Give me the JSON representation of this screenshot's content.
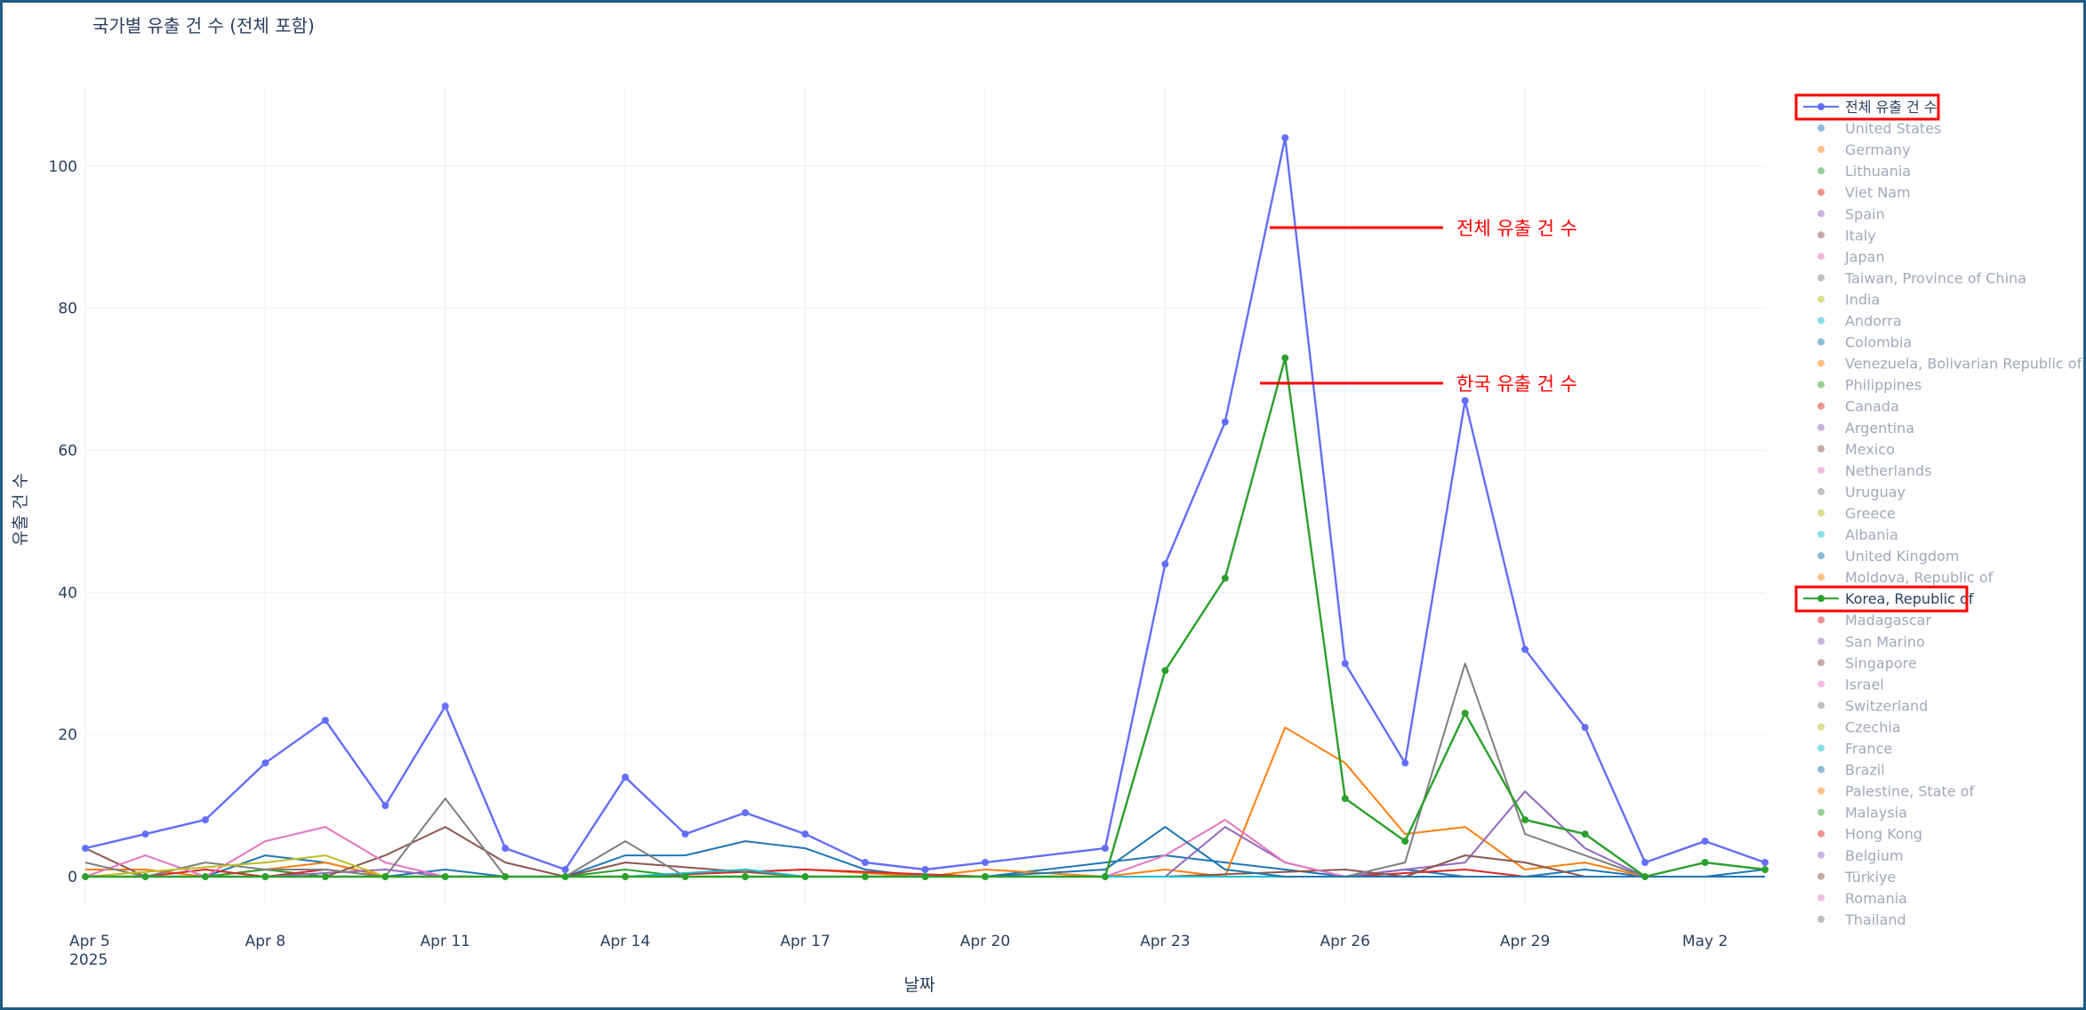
{
  "chart_data": {
    "type": "line",
    "title": "국가별 유출 건 수 (전체 포함)",
    "xlabel": "날짜",
    "ylabel": "유출 건 수",
    "x_year": "2025",
    "x_start": "2025-04-05",
    "x_end": "2025-05-03",
    "ylim": [
      -4,
      111
    ],
    "y_ticks": [
      0,
      20,
      40,
      60,
      80,
      100
    ],
    "x_ticks": [
      {
        "date": "2025-04-05",
        "label": "Apr 5"
      },
      {
        "date": "2025-04-08",
        "label": "Apr 8"
      },
      {
        "date": "2025-04-11",
        "label": "Apr 11"
      },
      {
        "date": "2025-04-14",
        "label": "Apr 14"
      },
      {
        "date": "2025-04-17",
        "label": "Apr 17"
      },
      {
        "date": "2025-04-20",
        "label": "Apr 20"
      },
      {
        "date": "2025-04-23",
        "label": "Apr 23"
      },
      {
        "date": "2025-04-26",
        "label": "Apr 26"
      },
      {
        "date": "2025-04-29",
        "label": "Apr 29"
      },
      {
        "date": "2025-05-02",
        "label": "May 2"
      }
    ],
    "grid": true,
    "legend_position": "right",
    "series": [
      {
        "name": "전체 유출 건 수",
        "color": "#636efa",
        "visible": true,
        "markers": true,
        "highlight": true,
        "x": [
          "2025-04-05",
          "2025-04-06",
          "2025-04-07",
          "2025-04-08",
          "2025-04-09",
          "2025-04-10",
          "2025-04-11",
          "2025-04-12",
          "2025-04-13",
          "2025-04-14",
          "2025-04-15",
          "2025-04-16",
          "2025-04-17",
          "2025-04-18",
          "2025-04-19",
          "2025-04-20",
          "2025-04-22",
          "2025-04-23",
          "2025-04-24",
          "2025-04-25",
          "2025-04-26",
          "2025-04-27",
          "2025-04-28",
          "2025-04-29",
          "2025-04-30",
          "2025-05-01",
          "2025-05-02",
          "2025-05-03"
        ],
        "y": [
          4,
          6,
          8,
          16,
          22,
          10,
          24,
          4,
          1,
          14,
          6,
          9,
          6,
          2,
          1,
          2,
          4,
          44,
          64,
          104,
          30,
          16,
          67,
          32,
          21,
          2,
          5,
          2
        ]
      },
      {
        "name": "United States",
        "color": "#1f77b4",
        "visible": false,
        "x": [
          "2025-04-05",
          "2025-04-07",
          "2025-04-08",
          "2025-04-09",
          "2025-04-10",
          "2025-04-11",
          "2025-04-12",
          "2025-04-13",
          "2025-04-14",
          "2025-04-15",
          "2025-04-16",
          "2025-04-17",
          "2025-04-18",
          "2025-04-19",
          "2025-04-20",
          "2025-04-22",
          "2025-04-23",
          "2025-04-24",
          "2025-04-25",
          "2025-04-26",
          "2025-04-27",
          "2025-04-28",
          "2025-04-29",
          "2025-04-30",
          "2025-05-01",
          "2025-05-02",
          "2025-05-03"
        ],
        "y": [
          0,
          0,
          3,
          2,
          0,
          1,
          0,
          0,
          3,
          3,
          5,
          4,
          1,
          0,
          0,
          2,
          3,
          2,
          1,
          0,
          1,
          0,
          0,
          1,
          0,
          0,
          1
        ]
      },
      {
        "name": "Germany",
        "color": "#ff7f0e",
        "visible": false,
        "x": [
          "2025-04-05",
          "2025-04-06",
          "2025-04-07",
          "2025-04-08",
          "2025-04-09",
          "2025-04-10",
          "2025-04-11",
          "2025-04-14",
          "2025-04-17",
          "2025-04-19",
          "2025-04-20",
          "2025-04-22",
          "2025-04-23",
          "2025-04-24",
          "2025-04-25",
          "2025-04-26",
          "2025-04-27",
          "2025-04-28",
          "2025-04-29",
          "2025-04-30",
          "2025-05-01",
          "2025-05-02",
          "2025-05-03"
        ],
        "y": [
          1,
          1,
          0,
          1,
          2,
          0,
          0,
          0,
          1,
          0,
          1,
          0,
          1,
          0,
          21,
          16,
          6,
          7,
          1,
          2,
          0,
          0,
          0
        ]
      },
      {
        "name": "Lithuania",
        "color": "#2ca02c",
        "visible": false,
        "markers": true,
        "x": [
          "2025-04-05",
          "2025-04-06",
          "2025-04-07",
          "2025-04-08",
          "2025-04-09",
          "2025-04-10",
          "2025-04-11",
          "2025-04-13",
          "2025-04-14",
          "2025-04-15",
          "2025-04-17",
          "2025-04-18",
          "2025-04-19",
          "2025-04-20",
          "2025-04-22",
          "2025-04-23",
          "2025-04-24",
          "2025-04-25",
          "2025-04-26",
          "2025-04-27",
          "2025-04-28",
          "2025-04-29",
          "2025-04-30",
          "2025-05-01",
          "2025-05-02",
          "2025-05-03"
        ],
        "y": [
          0,
          0,
          0,
          1,
          0,
          0,
          0,
          0,
          1,
          0,
          0,
          0,
          0,
          0,
          0,
          29,
          42,
          73,
          11,
          5,
          23,
          8,
          6,
          0,
          2,
          1
        ]
      },
      {
        "name": "Viet Nam",
        "color": "#d62728",
        "visible": false,
        "x": [
          "2025-04-05",
          "2025-04-06",
          "2025-04-07",
          "2025-04-08",
          "2025-04-09",
          "2025-04-10",
          "2025-04-11",
          "2025-04-14",
          "2025-04-17",
          "2025-04-20",
          "2025-04-23",
          "2025-04-26",
          "2025-04-28",
          "2025-04-29",
          "2025-05-01",
          "2025-05-03"
        ],
        "y": [
          0,
          0,
          1,
          0,
          1,
          0,
          0,
          0,
          1,
          0,
          0,
          0,
          1,
          0,
          0,
          0
        ]
      },
      {
        "name": "Spain",
        "color": "#9467bd",
        "visible": false,
        "x": [
          "2025-04-05",
          "2025-04-08",
          "2025-04-10",
          "2025-04-11",
          "2025-04-14",
          "2025-04-20",
          "2025-04-23",
          "2025-04-24",
          "2025-04-25",
          "2025-04-26",
          "2025-04-27",
          "2025-04-28",
          "2025-04-29",
          "2025-04-30",
          "2025-05-01",
          "2025-05-03"
        ],
        "y": [
          0,
          0,
          1,
          0,
          0,
          0,
          0,
          7,
          2,
          0,
          1,
          2,
          12,
          4,
          0,
          0
        ]
      },
      {
        "name": "Italy",
        "color": "#8c564b",
        "visible": false,
        "x": [
          "2025-04-05",
          "2025-04-06",
          "2025-04-07",
          "2025-04-08",
          "2025-04-09",
          "2025-04-10",
          "2025-04-11",
          "2025-04-12",
          "2025-04-13",
          "2025-04-14",
          "2025-04-17",
          "2025-04-20",
          "2025-04-23",
          "2025-04-26",
          "2025-04-27",
          "2025-04-28",
          "2025-04-29",
          "2025-04-30",
          "2025-05-01",
          "2025-05-03"
        ],
        "y": [
          4,
          0,
          0,
          0,
          0,
          3,
          7,
          2,
          0,
          2,
          0,
          0,
          0,
          1,
          0,
          3,
          2,
          0,
          0,
          0
        ]
      },
      {
        "name": "Japan",
        "color": "#e377c2",
        "visible": false,
        "x": [
          "2025-04-05",
          "2025-04-06",
          "2025-04-07",
          "2025-04-08",
          "2025-04-09",
          "2025-04-10",
          "2025-04-11",
          "2025-04-14",
          "2025-04-17",
          "2025-04-20",
          "2025-04-22",
          "2025-04-23",
          "2025-04-24",
          "2025-04-25",
          "2025-04-26",
          "2025-04-29",
          "2025-05-03"
        ],
        "y": [
          0,
          3,
          0,
          5,
          7,
          2,
          0,
          0,
          0,
          0,
          0,
          3,
          8,
          2,
          0,
          0,
          0
        ]
      },
      {
        "name": "Taiwan, Province of China",
        "color": "#7f7f7f",
        "visible": false,
        "x": [
          "2025-04-05",
          "2025-04-06",
          "2025-04-07",
          "2025-04-08",
          "2025-04-09",
          "2025-04-10",
          "2025-04-11",
          "2025-04-12",
          "2025-04-13",
          "2025-04-14",
          "2025-04-15",
          "2025-04-17",
          "2025-04-20",
          "2025-04-23",
          "2025-04-26",
          "2025-04-27",
          "2025-04-28",
          "2025-04-29",
          "2025-04-30",
          "2025-05-01",
          "2025-05-03"
        ],
        "y": [
          2,
          0,
          2,
          1,
          1,
          0,
          11,
          0,
          0,
          5,
          0,
          0,
          0,
          0,
          0,
          2,
          30,
          6,
          3,
          0,
          0
        ]
      },
      {
        "name": "India",
        "color": "#bcbd22",
        "visible": false,
        "x": [
          "2025-04-05",
          "2025-04-08",
          "2025-04-09",
          "2025-04-10",
          "2025-04-11",
          "2025-04-14",
          "2025-04-20",
          "2025-04-23",
          "2025-04-26",
          "2025-05-03"
        ],
        "y": [
          0,
          2,
          3,
          0,
          0,
          0,
          0,
          0,
          0,
          0
        ]
      },
      {
        "name": "Andorra",
        "color": "#17becf",
        "visible": false,
        "x": [
          "2025-04-05",
          "2025-04-14",
          "2025-04-16",
          "2025-04-17",
          "2025-04-23",
          "2025-05-03"
        ],
        "y": [
          0,
          0,
          1,
          0,
          0,
          0
        ]
      },
      {
        "name": "Colombia",
        "color": "#1f77b4",
        "visible": false,
        "x": [
          "2025-04-05",
          "2025-04-20",
          "2025-04-22",
          "2025-04-23",
          "2025-04-24",
          "2025-04-25",
          "2025-05-03"
        ],
        "y": [
          0,
          0,
          1,
          7,
          1,
          0,
          0
        ]
      },
      {
        "name": "Venezuela, Bolivarian Republic of",
        "color": "#ff7f0e",
        "visible": false,
        "x": [],
        "y": []
      },
      {
        "name": "Philippines",
        "color": "#2ca02c",
        "visible": false,
        "x": [],
        "y": []
      },
      {
        "name": "Canada",
        "color": "#d62728",
        "visible": false,
        "x": [],
        "y": []
      },
      {
        "name": "Argentina",
        "color": "#9467bd",
        "visible": false,
        "x": [],
        "y": []
      },
      {
        "name": "Mexico",
        "color": "#8c564b",
        "visible": false,
        "x": [],
        "y": []
      },
      {
        "name": "Netherlands",
        "color": "#e377c2",
        "visible": false,
        "x": [],
        "y": []
      },
      {
        "name": "Uruguay",
        "color": "#7f7f7f",
        "visible": false,
        "x": [],
        "y": []
      },
      {
        "name": "Greece",
        "color": "#bcbd22",
        "visible": false,
        "x": [],
        "y": []
      },
      {
        "name": "Albania",
        "color": "#17becf",
        "visible": false,
        "x": [],
        "y": []
      },
      {
        "name": "United Kingdom",
        "color": "#1f77b4",
        "visible": false,
        "x": [],
        "y": []
      },
      {
        "name": "Moldova, Republic of",
        "color": "#ff7f0e",
        "visible": false,
        "x": [],
        "y": []
      },
      {
        "name": "Korea, Republic of",
        "color": "#2ca02c",
        "visible": true,
        "markers": true,
        "highlight": true,
        "x": [
          "2025-04-05",
          "2025-04-06",
          "2025-04-07",
          "2025-04-08",
          "2025-04-09",
          "2025-04-10",
          "2025-04-11",
          "2025-04-12",
          "2025-04-13",
          "2025-04-14",
          "2025-04-15",
          "2025-04-16",
          "2025-04-17",
          "2025-04-18",
          "2025-04-19",
          "2025-04-20",
          "2025-04-22",
          "2025-04-23",
          "2025-04-24",
          "2025-04-25",
          "2025-04-26",
          "2025-04-27",
          "2025-04-28",
          "2025-04-29",
          "2025-04-30",
          "2025-05-01",
          "2025-05-02",
          "2025-05-03"
        ],
        "y": [
          0,
          0,
          0,
          0,
          0,
          0,
          0,
          0,
          0,
          0,
          0,
          0,
          0,
          0,
          0,
          0,
          0,
          29,
          42,
          73,
          11,
          5,
          23,
          8,
          6,
          0,
          2,
          1
        ]
      },
      {
        "name": "Madagascar",
        "color": "#d62728",
        "visible": false,
        "x": [],
        "y": []
      },
      {
        "name": "San Marino",
        "color": "#9467bd",
        "visible": false,
        "x": [],
        "y": []
      },
      {
        "name": "Singapore",
        "color": "#8c564b",
        "visible": false,
        "x": [],
        "y": []
      },
      {
        "name": "Israel",
        "color": "#e377c2",
        "visible": false,
        "x": [],
        "y": []
      },
      {
        "name": "Switzerland",
        "color": "#7f7f7f",
        "visible": false,
        "x": [],
        "y": []
      },
      {
        "name": "Czechia",
        "color": "#bcbd22",
        "visible": false,
        "x": [],
        "y": []
      },
      {
        "name": "France",
        "color": "#17becf",
        "visible": false,
        "x": [],
        "y": []
      },
      {
        "name": "Brazil",
        "color": "#1f77b4",
        "visible": false,
        "x": [],
        "y": []
      },
      {
        "name": "Palestine, State of",
        "color": "#ff7f0e",
        "visible": false,
        "x": [],
        "y": []
      },
      {
        "name": "Malaysia",
        "color": "#2ca02c",
        "visible": false,
        "x": [],
        "y": []
      },
      {
        "name": "Hong Kong",
        "color": "#d62728",
        "visible": false,
        "x": [],
        "y": []
      },
      {
        "name": "Belgium",
        "color": "#9467bd",
        "visible": false,
        "x": [],
        "y": []
      },
      {
        "name": "Türkiye",
        "color": "#8c564b",
        "visible": false,
        "x": [],
        "y": []
      },
      {
        "name": "Romania",
        "color": "#e377c2",
        "visible": false,
        "x": [],
        "y": []
      },
      {
        "name": "Thailand",
        "color": "#7f7f7f",
        "visible": false,
        "x": [],
        "y": []
      }
    ],
    "annotations": [
      {
        "text": "전체 유출 건 수",
        "color": "#ff0000",
        "series": "전체 유출 건 수"
      },
      {
        "text": "한국 유출 건 수",
        "color": "#ff0000",
        "series": "Korea, Republic of"
      }
    ],
    "colors": {
      "grid": "#ebf0f8",
      "zeroline": "#d0d5de",
      "text": "#2a3f5f",
      "legend_active": "#2a3f5f",
      "legend_inactive": "#a0a9b8",
      "highlight_box": "#ff0000",
      "frame": "#1f5a82"
    }
  }
}
